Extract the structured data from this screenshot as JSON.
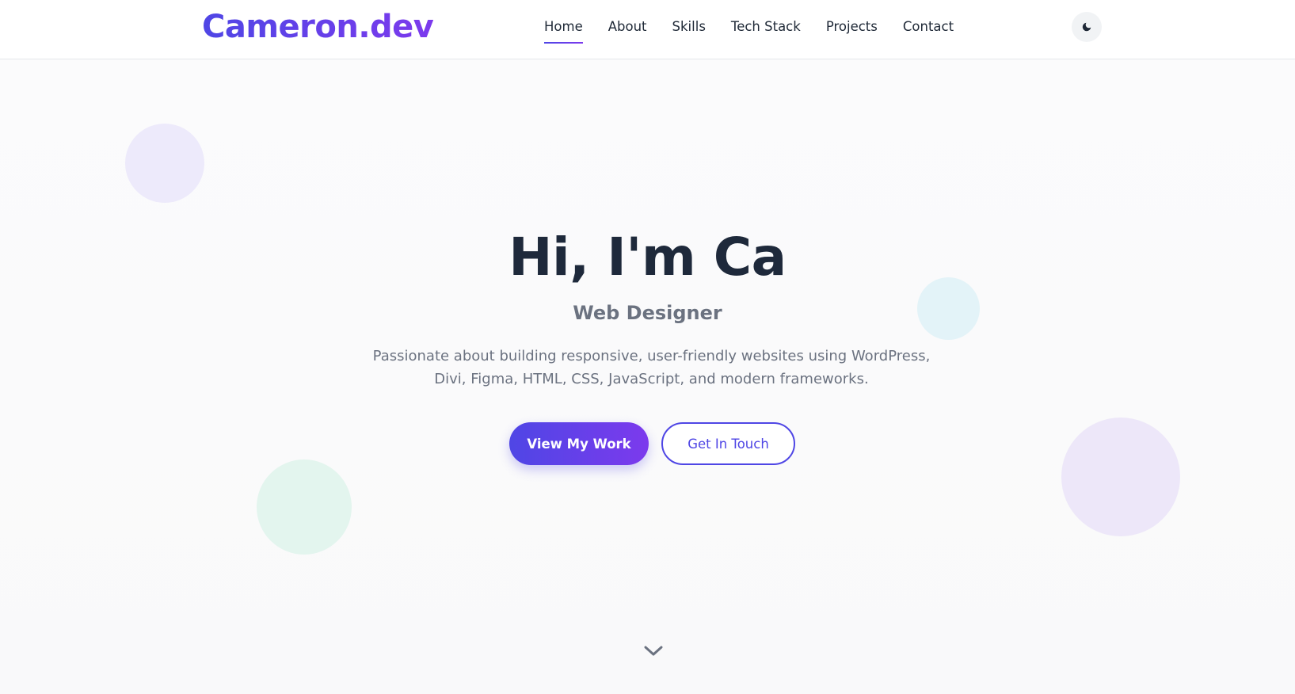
{
  "header": {
    "logo": "Cameron.dev",
    "nav": [
      {
        "label": "Home",
        "active": true
      },
      {
        "label": "About"
      },
      {
        "label": "Skills"
      },
      {
        "label": "Tech Stack"
      },
      {
        "label": "Projects"
      },
      {
        "label": "Contact"
      }
    ],
    "theme_toggle_icon": "moon-icon"
  },
  "hero": {
    "title": "Hi, I'm Ca",
    "subtitle": "Web Designer",
    "description_line1": "Passionate about building responsive, user-friendly websites using WordPress,",
    "description_line2": "Divi, Figma, HTML, CSS, JavaScript, and modern frameworks.",
    "primary_button": "View My Work",
    "secondary_button": "Get In Touch",
    "scroll_icon": "chevron-down-icon"
  },
  "colors": {
    "accent_start": "#4f46e5",
    "accent_end": "#7c3aed",
    "text_dark": "#1e293b",
    "text_muted": "#6b7280"
  }
}
